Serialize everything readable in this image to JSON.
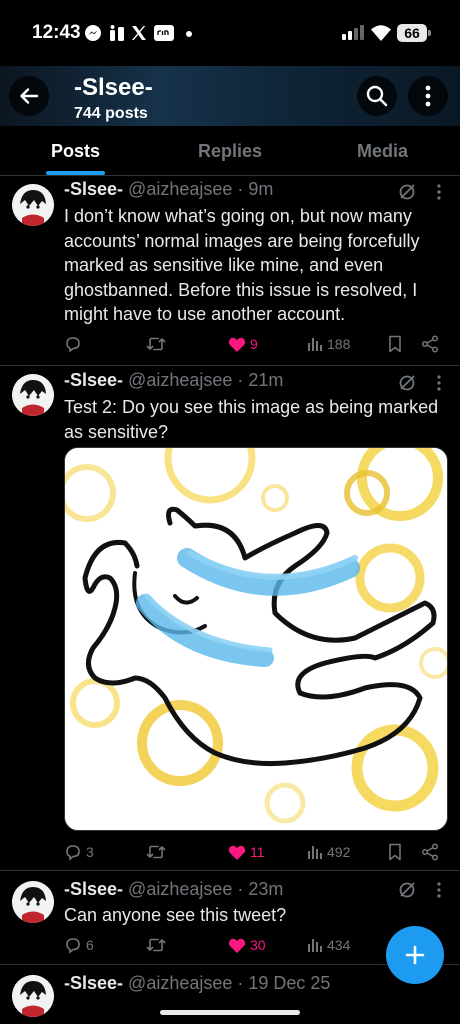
{
  "status_bar": {
    "time": "12:43",
    "battery": "66"
  },
  "header": {
    "name": "-Slsee-",
    "post_count": "744 posts"
  },
  "tabs": [
    {
      "label": "Posts",
      "active": true
    },
    {
      "label": "Replies",
      "active": false
    },
    {
      "label": "Media",
      "active": false
    }
  ],
  "tweets": [
    {
      "name": "-Slsee-",
      "meta": "@aizheajsee · 9m",
      "text": "I don’t know what’s going on, but now many accounts’ normal images are being forcefully marked as sensitive like mine, and even ghostbanned. Before this issue is resolved, I might have to use another account.",
      "replies": "",
      "retweets": "",
      "likes": "9",
      "views": "188"
    },
    {
      "name": "-Slsee-",
      "meta": "@aizheajsee · 21m",
      "text": "Test 2: Do you see this image as being marked as sensitive?",
      "replies": "3",
      "retweets": "",
      "likes": "11",
      "views": "492"
    },
    {
      "name": "-Slsee-",
      "meta": "@aizheajsee · 23m",
      "text": "Can anyone see this tweet?",
      "replies": "6",
      "retweets": "",
      "likes": "30",
      "views": "434"
    },
    {
      "name": "-Slsee-",
      "meta": "@aizheajsee · 19 Dec 25",
      "text": ""
    }
  ],
  "colors": {
    "accent": "#1d9bf0",
    "like": "#f91880",
    "muted": "#71767b",
    "divider": "#2f3336"
  },
  "icons": [
    "back-arrow-icon",
    "search-icon",
    "more-vertical-icon",
    "grok-icon",
    "more-dots-icon",
    "reply-icon",
    "retweet-icon",
    "heart-icon",
    "views-icon",
    "bookmark-icon",
    "share-icon",
    "compose-plus-icon"
  ]
}
